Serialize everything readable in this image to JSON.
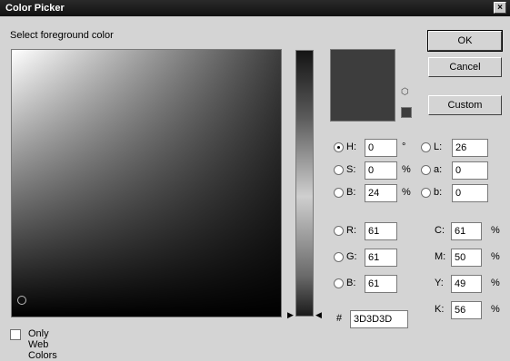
{
  "window": {
    "title": "Color Picker",
    "close_label": "×"
  },
  "prompt": "Select foreground color",
  "current_color": "#3d3d3d",
  "buttons": {
    "ok": "OK",
    "cancel": "Cancel",
    "custom": "Custom"
  },
  "hsb": [
    {
      "label": "H:",
      "value": "0",
      "unit": "°",
      "selected": true
    },
    {
      "label": "S:",
      "value": "0",
      "unit": "%",
      "selected": false
    },
    {
      "label": "B:",
      "value": "24",
      "unit": "%",
      "selected": false
    }
  ],
  "lab": [
    {
      "label": "L:",
      "value": "26"
    },
    {
      "label": "a:",
      "value": "0"
    },
    {
      "label": "b:",
      "value": "0"
    }
  ],
  "rgb": [
    {
      "label": "R:",
      "value": "61"
    },
    {
      "label": "G:",
      "value": "61"
    },
    {
      "label": "B:",
      "value": "61"
    }
  ],
  "cmyk": [
    {
      "label": "C:",
      "value": "61",
      "unit": "%"
    },
    {
      "label": "M:",
      "value": "50",
      "unit": "%"
    },
    {
      "label": "Y:",
      "value": "49",
      "unit": "%"
    },
    {
      "label": "K:",
      "value": "56",
      "unit": "%"
    }
  ],
  "hex": {
    "label": "#",
    "value": "3D3D3D"
  },
  "web_only": {
    "label": "Only Web Colors",
    "checked": false
  },
  "icons": {
    "gamut": "cube-icon",
    "slider_arrows": "triangle-icon"
  }
}
